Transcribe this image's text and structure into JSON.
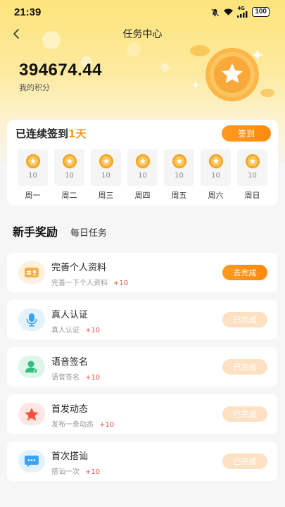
{
  "status_bar": {
    "time": "21:39",
    "network_label": "4G",
    "battery": "100"
  },
  "nav": {
    "title": "任务中心"
  },
  "points": {
    "value": "394674.44",
    "label": "我的积分"
  },
  "signin": {
    "title_prefix": "已连续签到",
    "streak_days": "1天",
    "button_label": "签到",
    "days": [
      {
        "label": "周一",
        "amount": "10"
      },
      {
        "label": "周二",
        "amount": "10"
      },
      {
        "label": "周三",
        "amount": "10"
      },
      {
        "label": "周四",
        "amount": "10"
      },
      {
        "label": "周五",
        "amount": "10"
      },
      {
        "label": "周六",
        "amount": "10"
      },
      {
        "label": "周日",
        "amount": "10"
      }
    ]
  },
  "tabs": {
    "active": "新手奖励",
    "other": "每日任务"
  },
  "tasks": [
    {
      "name": "完善个人资料",
      "desc": "完善一下个人资料",
      "reward": "+10",
      "button": "去完成",
      "icon": "id-card-icon",
      "state": "active"
    },
    {
      "name": "真人认证",
      "desc": "真人认证",
      "reward": "+10",
      "button": "已完成",
      "icon": "microphone-icon",
      "state": "done"
    },
    {
      "name": "语音签名",
      "desc": "语音签名",
      "reward": "+10",
      "button": "已完成",
      "icon": "voice-user-icon",
      "state": "done"
    },
    {
      "name": "首发动态",
      "desc": "发布一条动态",
      "reward": "+10",
      "button": "已完成",
      "icon": "star-icon",
      "state": "done"
    },
    {
      "name": "首次搭讪",
      "desc": "搭讪一次",
      "reward": "+10",
      "button": "已完成",
      "icon": "chat-bubble-icon",
      "state": "done"
    }
  ],
  "colors": {
    "accent": "#fd8a0c",
    "reward": "#e8504b",
    "done_button": "#fde1c2"
  }
}
